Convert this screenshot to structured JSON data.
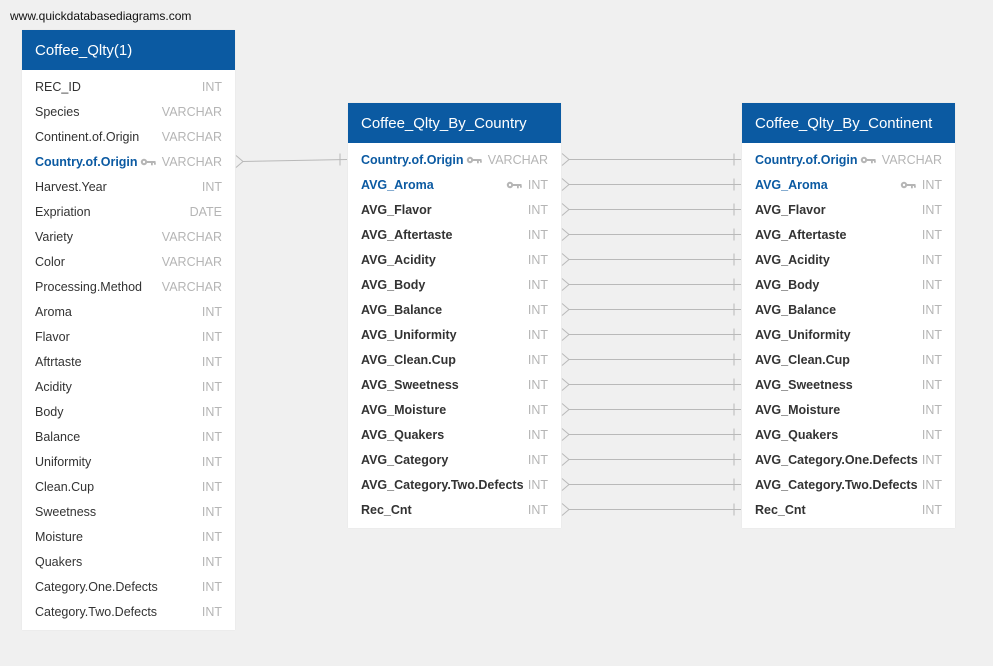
{
  "watermark": "www.quickdatabasediagrams.com",
  "tables": [
    {
      "title": "Coffee_Qlty(1)",
      "style": "normal",
      "fields": [
        {
          "name": "REC_ID",
          "type": "INT"
        },
        {
          "name": "Species",
          "type": "VARCHAR"
        },
        {
          "name": "Continent.of.Origin",
          "type": "VARCHAR"
        },
        {
          "name": "Country.of.Origin",
          "type": "VARCHAR",
          "key": true
        },
        {
          "name": "Harvest.Year",
          "type": "INT"
        },
        {
          "name": "Expriation",
          "type": "DATE"
        },
        {
          "name": "Variety",
          "type": "VARCHAR"
        },
        {
          "name": "Color",
          "type": "VARCHAR"
        },
        {
          "name": "Processing.Method",
          "type": "VARCHAR"
        },
        {
          "name": "Aroma",
          "type": "INT"
        },
        {
          "name": "Flavor",
          "type": "INT"
        },
        {
          "name": "Aftrtaste",
          "type": "INT"
        },
        {
          "name": "Acidity",
          "type": "INT"
        },
        {
          "name": "Body",
          "type": "INT"
        },
        {
          "name": "Balance",
          "type": "INT"
        },
        {
          "name": "Uniformity",
          "type": "INT"
        },
        {
          "name": "Clean.Cup",
          "type": "INT"
        },
        {
          "name": "Sweetness",
          "type": "INT"
        },
        {
          "name": "Moisture",
          "type": "INT"
        },
        {
          "name": "Quakers",
          "type": "INT"
        },
        {
          "name": "Category.One.Defects",
          "type": "INT"
        },
        {
          "name": "Category.Two.Defects",
          "type": "INT"
        }
      ]
    },
    {
      "title": "Coffee_Qlty_By_Country",
      "style": "bold",
      "fields": [
        {
          "name": "Country.of.Origin",
          "type": "VARCHAR",
          "key": true
        },
        {
          "name": "AVG_Aroma",
          "type": "INT",
          "key": true
        },
        {
          "name": "AVG_Flavor",
          "type": "INT"
        },
        {
          "name": "AVG_Aftertaste",
          "type": "INT"
        },
        {
          "name": "AVG_Acidity",
          "type": "INT"
        },
        {
          "name": "AVG_Body",
          "type": "INT"
        },
        {
          "name": "AVG_Balance",
          "type": "INT"
        },
        {
          "name": "AVG_Uniformity",
          "type": "INT"
        },
        {
          "name": "AVG_Clean.Cup",
          "type": "INT"
        },
        {
          "name": "AVG_Sweetness",
          "type": "INT"
        },
        {
          "name": "AVG_Moisture",
          "type": "INT"
        },
        {
          "name": "AVG_Quakers",
          "type": "INT"
        },
        {
          "name": "AVG_Category",
          "type": "INT"
        },
        {
          "name": "AVG_Category.Two.Defects",
          "type": "INT"
        },
        {
          "name": "Rec_Cnt",
          "type": "INT"
        }
      ]
    },
    {
      "title": "Coffee_Qlty_By_Continent",
      "style": "bold",
      "fields": [
        {
          "name": "Country.of.Origin",
          "type": "VARCHAR",
          "key": true
        },
        {
          "name": "AVG_Aroma",
          "type": "INT",
          "key": true
        },
        {
          "name": "AVG_Flavor",
          "type": "INT"
        },
        {
          "name": "AVG_Aftertaste",
          "type": "INT"
        },
        {
          "name": "AVG_Acidity",
          "type": "INT"
        },
        {
          "name": "AVG_Body",
          "type": "INT"
        },
        {
          "name": "AVG_Balance",
          "type": "INT"
        },
        {
          "name": "AVG_Uniformity",
          "type": "INT"
        },
        {
          "name": "AVG_Clean.Cup",
          "type": "INT"
        },
        {
          "name": "AVG_Sweetness",
          "type": "INT"
        },
        {
          "name": "AVG_Moisture",
          "type": "INT"
        },
        {
          "name": "AVG_Quakers",
          "type": "INT"
        },
        {
          "name": "AVG_Category.One.Defects",
          "type": "INT"
        },
        {
          "name": "AVG_Category.Two.Defects",
          "type": "INT"
        },
        {
          "name": "Rec_Cnt",
          "type": "INT"
        }
      ]
    }
  ],
  "relationships": [
    {
      "from_table": 0,
      "from_field": 3,
      "to_table": 1,
      "to_field": 0
    },
    {
      "from_table": 1,
      "from_field": 0,
      "to_table": 2,
      "to_field": 0
    },
    {
      "from_table": 1,
      "from_field": 1,
      "to_table": 2,
      "to_field": 1
    },
    {
      "from_table": 1,
      "from_field": 2,
      "to_table": 2,
      "to_field": 2
    },
    {
      "from_table": 1,
      "from_field": 3,
      "to_table": 2,
      "to_field": 3
    },
    {
      "from_table": 1,
      "from_field": 4,
      "to_table": 2,
      "to_field": 4
    },
    {
      "from_table": 1,
      "from_field": 5,
      "to_table": 2,
      "to_field": 5
    },
    {
      "from_table": 1,
      "from_field": 6,
      "to_table": 2,
      "to_field": 6
    },
    {
      "from_table": 1,
      "from_field": 7,
      "to_table": 2,
      "to_field": 7
    },
    {
      "from_table": 1,
      "from_field": 8,
      "to_table": 2,
      "to_field": 8
    },
    {
      "from_table": 1,
      "from_field": 9,
      "to_table": 2,
      "to_field": 9
    },
    {
      "from_table": 1,
      "from_field": 10,
      "to_table": 2,
      "to_field": 10
    },
    {
      "from_table": 1,
      "from_field": 11,
      "to_table": 2,
      "to_field": 11
    },
    {
      "from_table": 1,
      "from_field": 12,
      "to_table": 2,
      "to_field": 12
    },
    {
      "from_table": 1,
      "from_field": 13,
      "to_table": 2,
      "to_field": 13
    },
    {
      "from_table": 1,
      "from_field": 14,
      "to_table": 2,
      "to_field": 14
    }
  ],
  "colors": {
    "header": "#0b5aa2",
    "key": "#0b5aa2",
    "type": "#b5b5b5",
    "line": "#b9b9b9",
    "background": "#f0f0f0"
  }
}
